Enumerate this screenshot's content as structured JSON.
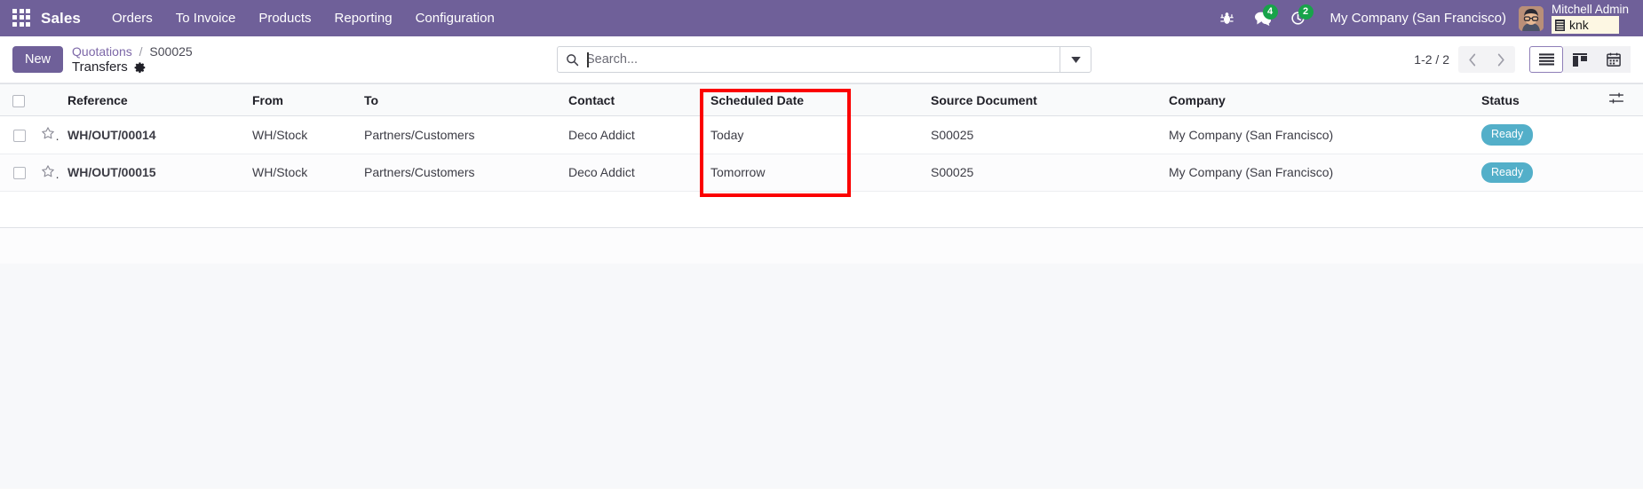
{
  "navbar": {
    "apps_icon": "apps-grid-icon",
    "brand": "Sales",
    "menu_items": [
      {
        "label": "Orders"
      },
      {
        "label": "To Invoice"
      },
      {
        "label": "Products"
      },
      {
        "label": "Reporting"
      },
      {
        "label": "Configuration"
      }
    ],
    "bug_icon": "bug-icon",
    "messages_icon": "messages-icon",
    "messages_count": "4",
    "activities_icon": "clock-activity-icon",
    "activities_count": "2",
    "company": "My Company (San Francisco)",
    "avatar_icon": "user-avatar",
    "user_name": "Mitchell Admin",
    "extension_chip": {
      "icon": "list-chip-icon",
      "label": "knk"
    },
    "colors": {
      "background": "#6f6099",
      "badge_green": "#18a34a",
      "chip_background": "#fdf7e3"
    }
  },
  "control_panel": {
    "new_button": "New",
    "breadcrumb": {
      "parent": "Quotations",
      "separator": "/",
      "record": "S00025",
      "current": "Transfers",
      "settings_icon": "gear-icon"
    },
    "search": {
      "icon": "search-icon",
      "placeholder": "Search...",
      "value": "",
      "dropdown_icon": "caret-down-icon"
    },
    "pager": {
      "text": "1-2 / 2",
      "previous_icon": "chevron-left-icon",
      "next_icon": "chevron-right-icon"
    },
    "view_switcher": [
      {
        "name": "list",
        "icon": "list-view-icon",
        "active": true
      },
      {
        "name": "kanban",
        "icon": "kanban-view-icon",
        "active": false
      },
      {
        "name": "calendar",
        "icon": "calendar-view-icon",
        "active": false
      }
    ]
  },
  "list_view": {
    "select_all_icon": "checkbox-icon",
    "columns": [
      {
        "key": "reference",
        "label": "Reference"
      },
      {
        "key": "from",
        "label": "From"
      },
      {
        "key": "to",
        "label": "To"
      },
      {
        "key": "contact",
        "label": "Contact"
      },
      {
        "key": "scheduled_date",
        "label": "Scheduled Date"
      },
      {
        "key": "source_document",
        "label": "Source Document"
      },
      {
        "key": "company",
        "label": "Company"
      },
      {
        "key": "status",
        "label": "Status"
      }
    ],
    "optional_columns_icon": "column-settings-icon",
    "rows": [
      {
        "reference": "WH/OUT/00014",
        "from": "WH/Stock",
        "to": "Partners/Customers",
        "contact": "Deco Addict",
        "scheduled_date": "Today",
        "scheduled_highlight": true,
        "source_document": "S00025",
        "company": "My Company (San Francisco)",
        "status": "Ready"
      },
      {
        "reference": "WH/OUT/00015",
        "from": "WH/Stock",
        "to": "Partners/Customers",
        "contact": "Deco Addict",
        "scheduled_date": "Tomorrow",
        "scheduled_highlight": false,
        "source_document": "S00025",
        "company": "My Company (San Francisco)",
        "status": "Ready"
      }
    ],
    "colors": {
      "status_badge": "#53afc9",
      "scheduled_today": "#9a7209",
      "header_background": "#f9fafb"
    }
  },
  "annotation": {
    "name": "scheduled-date-highlight",
    "color": "#fb0000",
    "target_column": "Scheduled Date"
  }
}
